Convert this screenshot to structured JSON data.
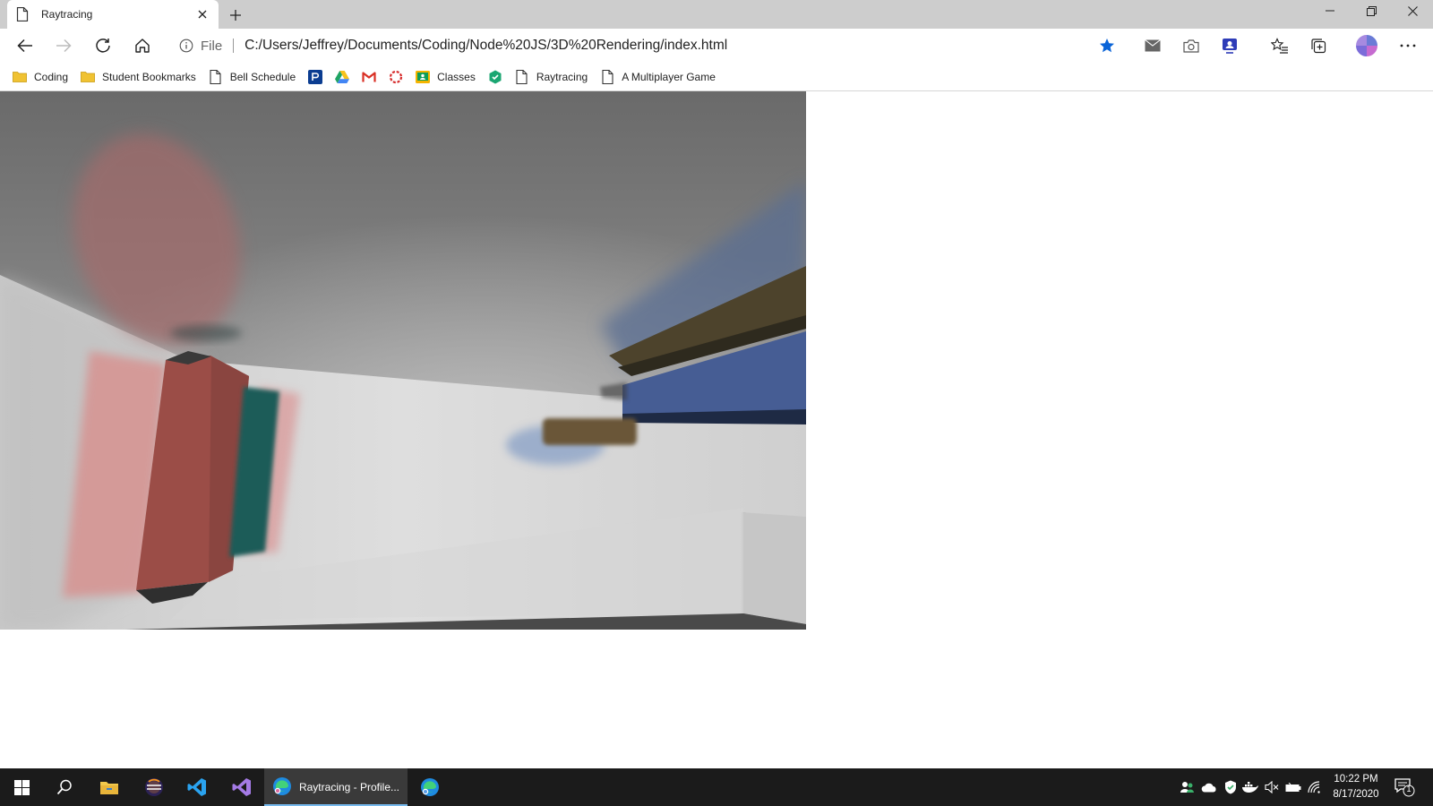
{
  "browser": {
    "tab": {
      "title": "Raytracing"
    },
    "address_bar": {
      "scheme_label": "File",
      "url": "C:/Users/Jeffrey/Documents/Coding/Node%20JS/3D%20Rendering/index.html"
    },
    "bookmarks": [
      {
        "label": "Coding",
        "icon": "folder-icon"
      },
      {
        "label": "Student Bookmarks",
        "icon": "folder-icon"
      },
      {
        "label": "Bell Schedule",
        "icon": "page-icon"
      },
      {
        "label": "",
        "icon": "pearson-icon"
      },
      {
        "label": "",
        "icon": "google-drive-icon"
      },
      {
        "label": "",
        "icon": "gmail-icon"
      },
      {
        "label": "",
        "icon": "red-ring-icon"
      },
      {
        "label": "Classes",
        "icon": "classroom-icon"
      },
      {
        "label": "",
        "icon": "green-shield-icon"
      },
      {
        "label": "Raytracing",
        "icon": "page-icon"
      },
      {
        "label": "A Multiplayer Game",
        "icon": "page-icon"
      }
    ],
    "accent_color": "#0a64d8"
  },
  "taskbar": {
    "active_window_label": "Raytracing - Profile...",
    "clock": {
      "time": "10:22 PM",
      "date": "8/17/2020"
    },
    "notification_count": "1"
  }
}
